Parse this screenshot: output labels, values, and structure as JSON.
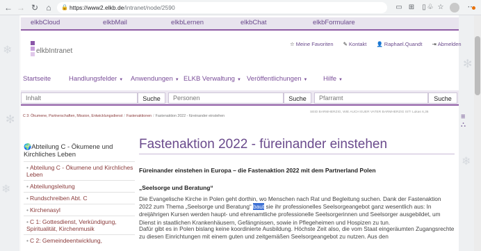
{
  "browser": {
    "url_host": "https://www2.elkb.de",
    "url_path": "/intranet/node/2590"
  },
  "topnav": [
    "elkbCloud",
    "elkbMail",
    "elkbLernen",
    "elkbChat",
    "elkbFormulare"
  ],
  "header": {
    "logo": "elkbIntranet",
    "favorites": "Meine Favoriten",
    "contact": "Kontakt",
    "user": "Raphael.Quandt",
    "logout": "Abmelden"
  },
  "menu": [
    "Startseite",
    "Handlungsfelder",
    "Anwendungen",
    "ELKB Verwaltung",
    "Veröffentlichungen",
    "Hilfe"
  ],
  "search": {
    "content_placeholder": "Inhalt",
    "content_button": "Suche",
    "persons_placeholder": "Personen",
    "persons_button": "Suche",
    "parish_placeholder": "Pfarramt",
    "parish_button": "Suche"
  },
  "breadcrumb": [
    "C 3: Ökumene, Partnerschaften, Mission, Entwicklungsdienst",
    "Fastenaktionen",
    "Fastenaktion 2022 - füreinander einstehen"
  ],
  "motto": "SEID BARMHERZIG, WIE AUCH EUER VATER BARMHERZIG IST! Lukas 6,36",
  "sidebar": {
    "title": "Abteilung C - Ökumene und Kirchliches Leben",
    "items": [
      "Abteilung C - Ökumene und Kirchliches Leben",
      "Abteilungsleitung",
      "Rundschreiben Abt. C",
      "Kirchenasyl",
      "C 1: Gottesdienst, Verkündigung, Spiritualität, Kirchenmusik",
      "C 2: Gemeindeentwicklung,"
    ]
  },
  "article": {
    "title": "Fastenaktion 2022 - füreinander einstehen",
    "heading": "Füreinander einstehen in Europa – die Fastenaktion 2022 mit dem Partnerland Polen",
    "subheading": "„Seelsorge und Beratung“",
    "p1_before": "Die Evangelische Kirche in Polen geht dorthin, wo Menschen nach Rat und Begleitung suchen. Dank der Fastenaktion 2022 zum Thema „Seelsorge und Beratung“ ",
    "p1_highlight": "baut",
    "p1_after": " sie ihr professionelles Seelsorgeangebot ganz wesentlich aus: In dreijährigen Kursen werden haupt- und ehrenamtliche professionelle Seelsorgerinnen und Seelsorger ausgebildet, um Dienst in staatlichen Krankenhäusern, Gefängnissen, sowie in Pflegeheimen und Hospizen zu tun.",
    "p2": "Dafür gibt es in Polen bislang keine koordinierte Ausbildung. Höchste Zeit also, die vom Staat eingeräumten Zugangsrechte zu diesen Einrichtungen mit einem guten und zeitgemäßen Seelsorgeangebot zu nutzen. Aus den"
  }
}
